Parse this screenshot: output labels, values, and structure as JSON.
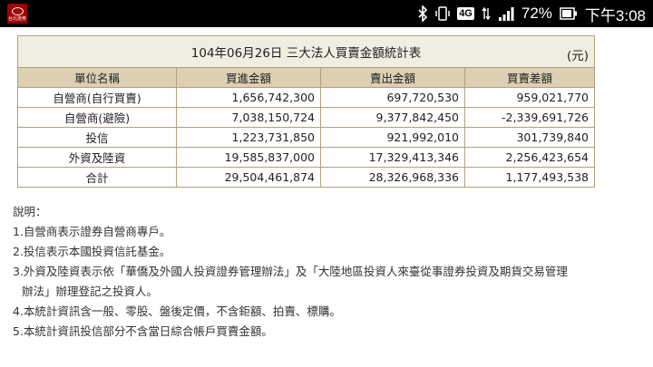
{
  "statusbar": {
    "app_icon_label": "台北證券",
    "battery_percent": "72%",
    "network": "4G",
    "time": "下午3:08"
  },
  "table": {
    "title": "104年06月26日  三大法人買賣金額統計表",
    "unit": "(元)",
    "headers": [
      "單位名稱",
      "買進金額",
      "賣出金額",
      "買賣差額"
    ],
    "rows": [
      {
        "name": "自營商(自行買賣)",
        "buy": "1,656,742,300",
        "sell": "697,720,530",
        "diff": "959,021,770"
      },
      {
        "name": "自營商(避險)",
        "buy": "7,038,150,724",
        "sell": "9,377,842,450",
        "diff": "-2,339,691,726"
      },
      {
        "name": "投信",
        "buy": "1,223,731,850",
        "sell": "921,992,010",
        "diff": "301,739,840"
      },
      {
        "name": "外資及陸資",
        "buy": "19,585,837,000",
        "sell": "17,329,413,346",
        "diff": "2,256,423,654"
      },
      {
        "name": "合計",
        "buy": "29,504,461,874",
        "sell": "28,326,968,336",
        "diff": "1,177,493,538"
      }
    ]
  },
  "notes": {
    "heading": "說明：",
    "items": [
      "1.自營商表示證券自營商專戶。",
      "2.投信表示本國投資信託基金。",
      "3.外資及陸資表示依「華僑及外國人投資證券管理辦法」及「大陸地區投資人來臺從事證券投資及期貨交易管理",
      "辦法」辦理登記之投資人。",
      "4.本統計資訊含一般、零股、盤後定價，不含鉅額、拍賣、標購。",
      "5.本統計資訊投信部分不含當日綜合帳戶買賣金額。"
    ]
  }
}
